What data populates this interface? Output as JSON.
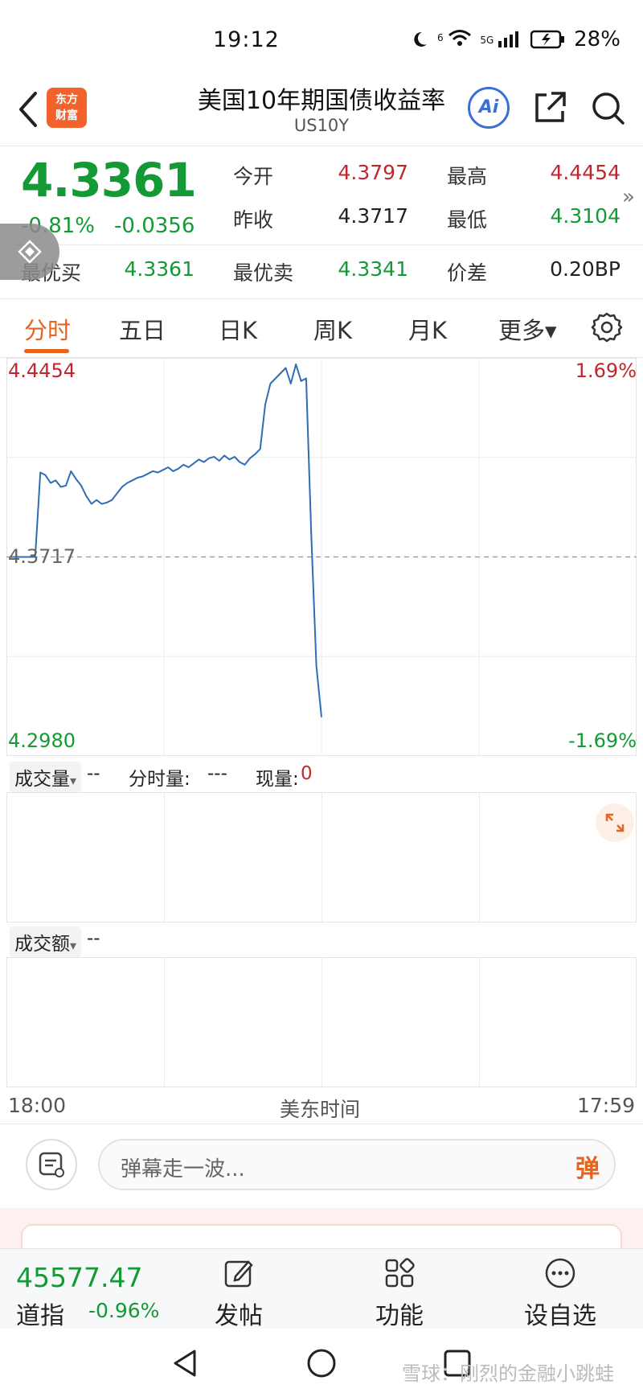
{
  "status_bar": {
    "time": "19:12",
    "signal_label": "5G",
    "wifi_label": "6",
    "battery": "28%"
  },
  "header": {
    "title": "美国10年期国债收益率",
    "subtitle": "US10Y",
    "logo_text_1": "东方",
    "logo_text_2": "财富",
    "ai_label": "Ai"
  },
  "quote": {
    "price": "4.3361",
    "change_pct": "-0.81%",
    "change_abs": "-0.0356",
    "open_label": "今开",
    "open_value": "4.3797",
    "high_label": "最高",
    "high_value": "4.4454",
    "prev_close_label": "昨收",
    "prev_close_value": "4.3717",
    "low_label": "最低",
    "low_value": "4.3104",
    "best_bid_label": "最优买",
    "best_bid_value": "4.3361",
    "best_ask_label": "最优卖",
    "best_ask_value": "4.3341",
    "spread_label": "价差",
    "spread_value": "0.20BP",
    "more_arrow": "»"
  },
  "tabs": [
    {
      "label": "分时",
      "active": true
    },
    {
      "label": "五日",
      "active": false
    },
    {
      "label": "日K",
      "active": false
    },
    {
      "label": "周K",
      "active": false
    },
    {
      "label": "月K",
      "active": false
    },
    {
      "label": "更多▾",
      "active": false
    }
  ],
  "chart_data": {
    "type": "line",
    "title": "",
    "xlabel": "美东时间",
    "ylabel": "",
    "x_ticks": [
      "18:00",
      "17:59"
    ],
    "ylim": [
      4.298,
      4.4454
    ],
    "y_labels_left": {
      "top": "4.4454",
      "mid": "4.3717",
      "bottom": "4.2980"
    },
    "y_labels_right": {
      "top": "1.69%",
      "bottom": "-1.69%"
    },
    "reference_line": 4.3717,
    "series": [
      {
        "values": [
          4.3717,
          4.3717,
          4.3717,
          4.3717,
          4.3717,
          4.3717,
          4.404,
          4.403,
          4.4,
          4.401,
          4.3985,
          4.399,
          4.4045,
          4.4015,
          4.399,
          4.395,
          4.392,
          4.3935,
          4.392,
          4.3925,
          4.3935,
          4.396,
          4.3985,
          4.4,
          4.401,
          4.402,
          4.4025,
          4.4035,
          4.4045,
          4.404,
          4.405,
          4.406,
          4.4045,
          4.4055,
          4.407,
          4.406,
          4.4075,
          4.409,
          4.408,
          4.4095,
          4.41,
          4.4085,
          4.4105,
          4.409,
          4.41,
          4.408,
          4.407,
          4.4095,
          4.411,
          4.413,
          4.43,
          4.438,
          4.44,
          4.442,
          4.444,
          4.438,
          4.4454,
          4.439,
          4.44,
          4.38,
          4.33,
          4.3104
        ]
      }
    ],
    "grid": true
  },
  "volume": {
    "label": "成交量",
    "dropdown": "▾",
    "value_dash": "--",
    "per_min_label": "分时量:",
    "per_min_value": "---",
    "current_label": "现量:",
    "current_value": "0"
  },
  "amount": {
    "label": "成交额",
    "dropdown": "▾",
    "value_dash": "--"
  },
  "time_axis": {
    "start": "18:00",
    "center": "美东时间",
    "end": "17:59"
  },
  "danmu": {
    "placeholder": "弹幕走一波...",
    "button": "弹"
  },
  "bottom_bar": {
    "index_value": "45577.47",
    "index_name": "道指",
    "index_change": "-0.96%",
    "post_label": "发帖",
    "func_label": "功能",
    "watch_label": "设自选"
  },
  "watermark": "雪球：刚烈的金融小跳蛙",
  "colors": {
    "up": "#c0272d",
    "down": "#139a34",
    "accent": "#e8641e",
    "line": "#2f6db5"
  }
}
